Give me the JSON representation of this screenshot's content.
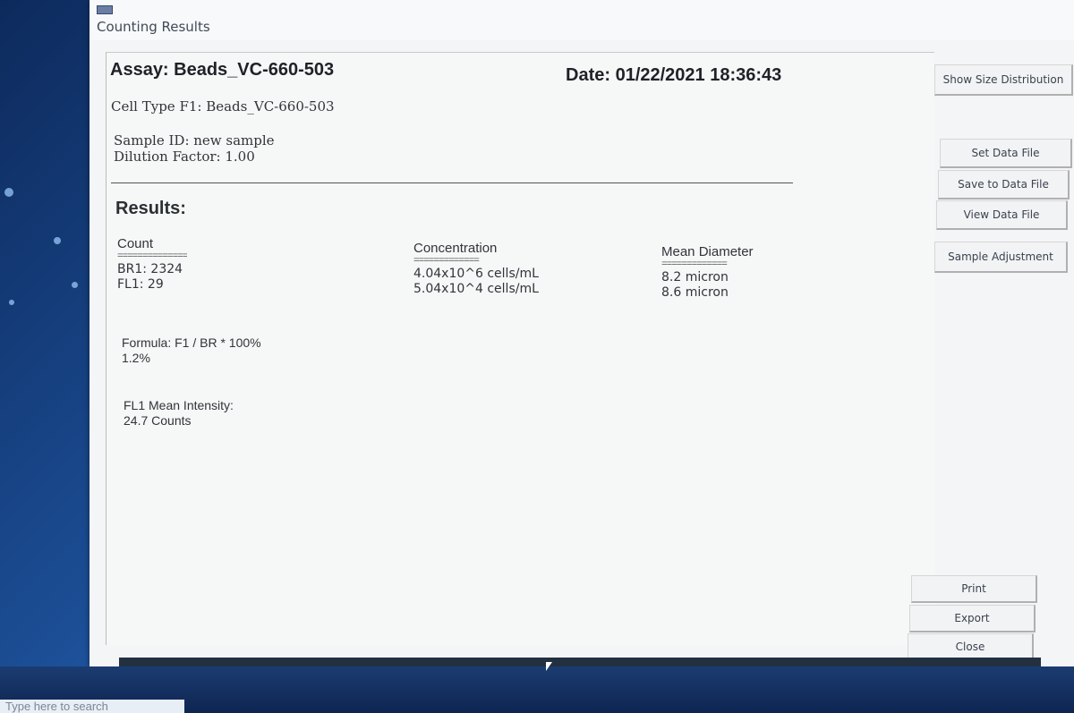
{
  "window": {
    "title": "Counting Results"
  },
  "report": {
    "assay": "Assay: Beads_VC-660-503",
    "date": "Date: 01/22/2021 18:36:43",
    "cell_type": "Cell Type F1: Beads_VC-660-503",
    "sample_id": "Sample ID: new sample",
    "dilution": "Dilution Factor: 1.00",
    "results_heading": "Results:",
    "count": {
      "header": "Count",
      "rule": "==============",
      "values": [
        "BR1: 2324",
        "FL1: 29"
      ]
    },
    "concentration": {
      "header": "Concentration",
      "rule": "=============",
      "values": [
        "4.04x10^6 cells/mL",
        "5.04x10^4 cells/mL"
      ]
    },
    "mean_diameter": {
      "header": "Mean Diameter",
      "rule": "=============",
      "values": [
        "8.2 micron",
        "8.6 micron"
      ]
    },
    "formula": {
      "label": "Formula:  F1 / BR * 100%",
      "value": "1.2%"
    },
    "intensity": {
      "label": "FL1 Mean Intensity:",
      "value": "24.7 Counts"
    }
  },
  "buttons": {
    "show_size": "Show Size Distribution",
    "set_data_file": "Set Data File",
    "save_data_file": "Save to Data File",
    "view_data_file": "View Data File",
    "sample_adjustment": "Sample Adjustment",
    "print": "Print",
    "export": "Export",
    "close": "Close"
  },
  "taskbar": {
    "search_placeholder": "Type here to search"
  }
}
